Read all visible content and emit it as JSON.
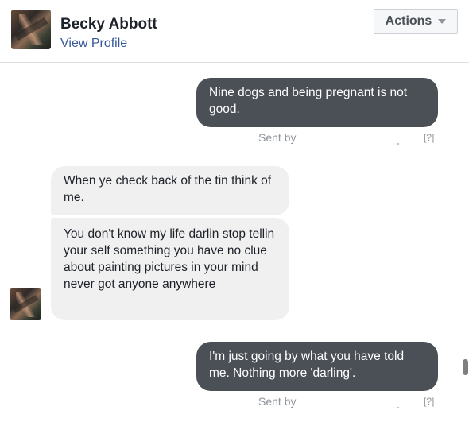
{
  "header": {
    "name": "Becky Abbott",
    "view_profile": "View Profile",
    "actions_label": "Actions"
  },
  "messages": [
    {
      "direction": "outgoing",
      "text": "Nine dogs and being pregnant is not good.",
      "status": "Sent by",
      "help": "[?]"
    },
    {
      "direction": "incoming",
      "text": "When ye check back of the tin think of me."
    },
    {
      "direction": "incoming",
      "text": "You don't know my life darlin stop tellin your self something you have no clue about painting pictures in your mind never got anyone anywhere"
    },
    {
      "direction": "outgoing",
      "text": "I'm just going by what you have told me. Nothing more 'darling'.",
      "status": "Sent by",
      "help": "[?]"
    }
  ],
  "colors": {
    "outgoing_bubble": "#4b4f56",
    "incoming_bubble": "#f1f0f0",
    "link": "#365899",
    "meta_text": "#90949c"
  },
  "icons": {
    "actions_caret": "caret-down-icon"
  }
}
